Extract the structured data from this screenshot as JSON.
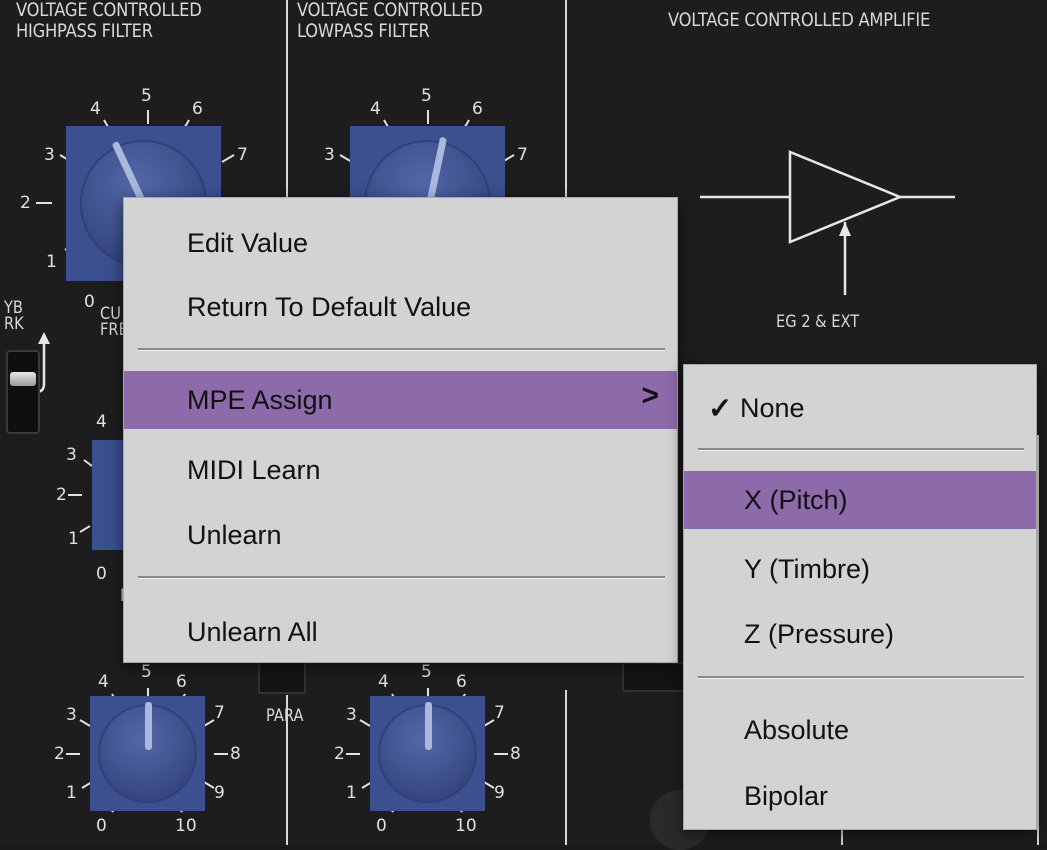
{
  "panel": {
    "sections": {
      "hpf_title_1": "VOLTAGE CONTROLLED",
      "hpf_title_2": "HIGHPASS FILTER",
      "lpf_title_1": "VOLTAGE CONTROLLED",
      "lpf_title_2": "LOWPASS FILTER",
      "vca_title": "VOLTAGE CONTROLLED AMPLIFIE"
    },
    "labels": {
      "eg_ext": "EG 2 & EXT",
      "para": "PARA",
      "kyb_1": "YB",
      "kyb_2": "RK",
      "cutoff_1": "CU",
      "cutoff_2": "FRE",
      "side_f": "F"
    },
    "knob_scale": {
      "n0": "0",
      "n1": "1",
      "n2": "2",
      "n3": "3",
      "n4": "4",
      "n5": "5",
      "n6": "6",
      "n7": "7",
      "n8": "8",
      "n9": "9",
      "n10": "10"
    }
  },
  "context_menu": {
    "items": [
      {
        "label": "Edit Value"
      },
      {
        "label": "Return To Default Value"
      },
      {
        "label": "MPE Assign",
        "submenu_indicator": ">"
      },
      {
        "label": "MIDI Learn"
      },
      {
        "label": "Unlearn"
      },
      {
        "label": "Unlearn All"
      }
    ],
    "highlighted": "MPE Assign"
  },
  "submenu": {
    "items": [
      {
        "label": "None",
        "checked": true,
        "check_glyph": "✓"
      },
      {
        "label": "X (Pitch)"
      },
      {
        "label": "Y (Timbre)"
      },
      {
        "label": "Z (Pressure)"
      },
      {
        "label": "Absolute"
      },
      {
        "label": "Bipolar"
      }
    ],
    "highlighted": "X (Pitch)"
  },
  "colors": {
    "menu_bg": "#d3d3d3",
    "highlight": "#8d6aaa",
    "panel_bg": "#1d1d1f",
    "knob_blue": "#3c4f8e"
  }
}
